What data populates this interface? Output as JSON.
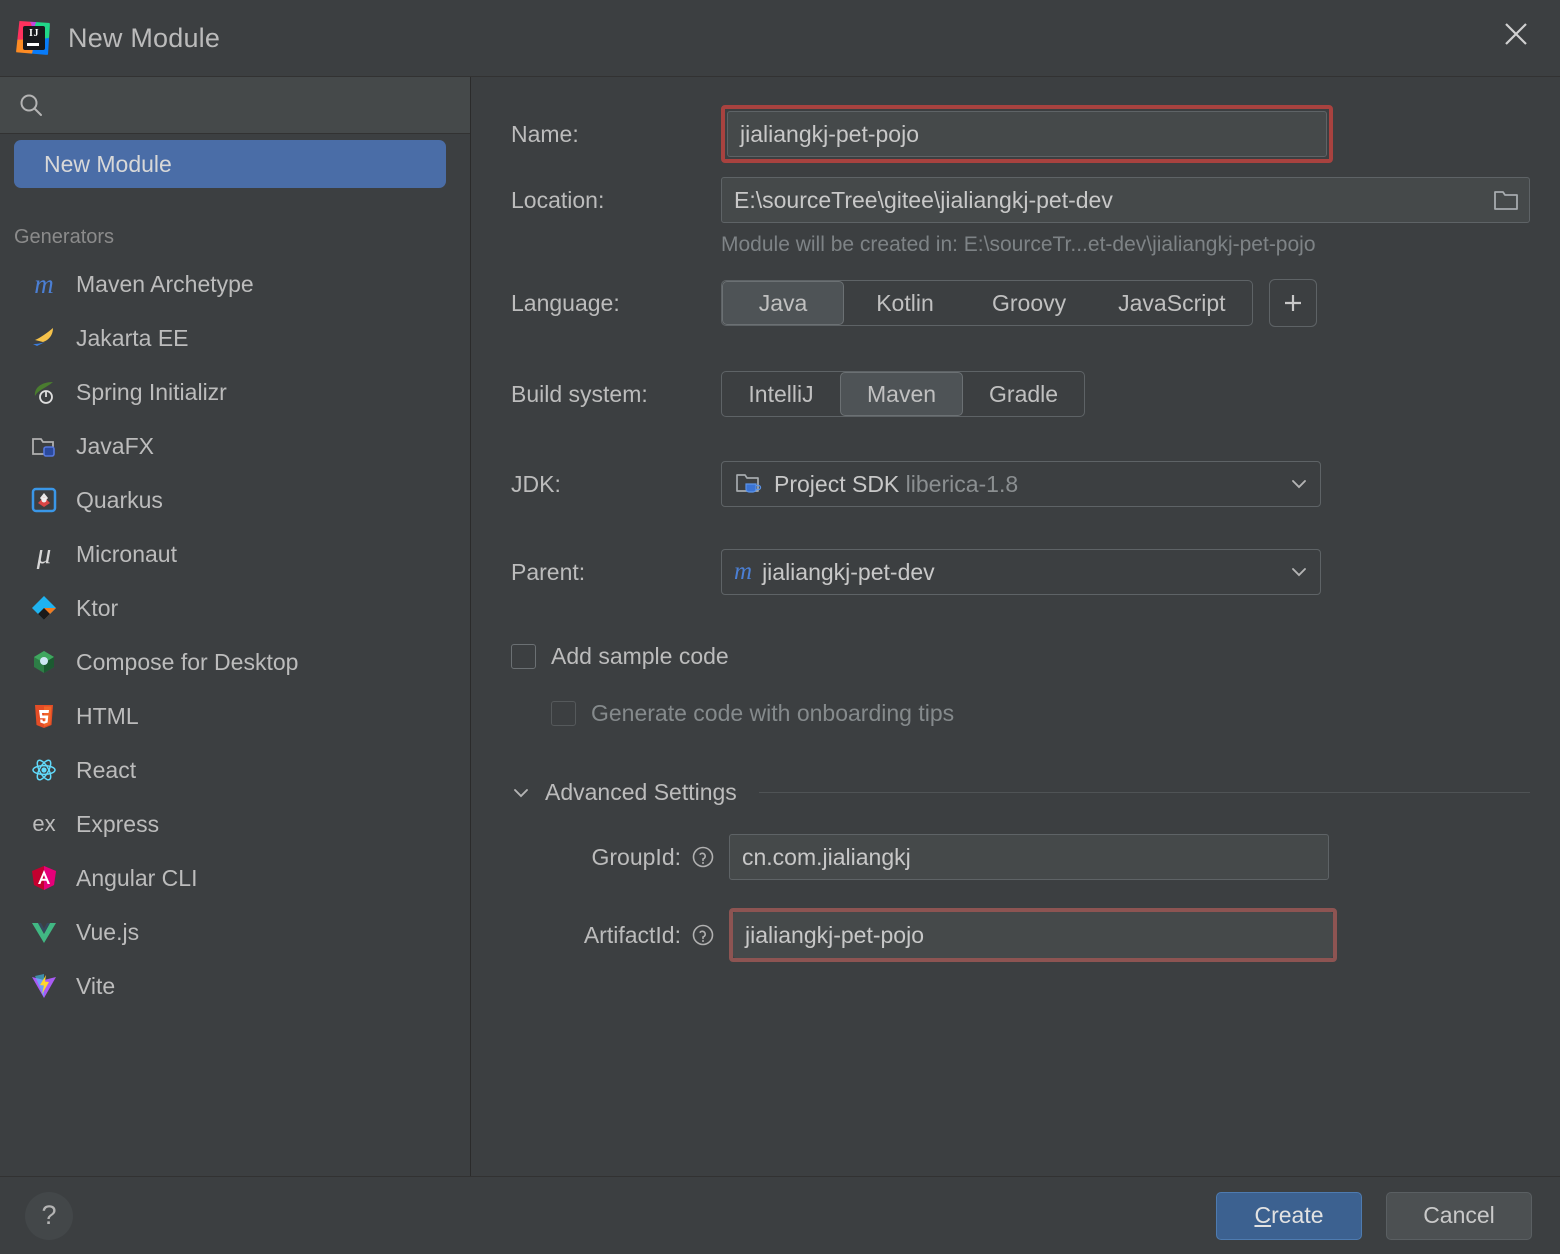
{
  "window": {
    "title": "New Module",
    "logo_icon": "intellij-idea-logo",
    "close_icon": "close-icon"
  },
  "sidebar": {
    "search": {
      "icon": "search-icon",
      "value": "",
      "placeholder": ""
    },
    "selected_item": "New Module",
    "generators_label": "Generators",
    "generators": [
      {
        "label": "Maven Archetype",
        "icon": "maven-icon"
      },
      {
        "label": "Jakarta EE",
        "icon": "jakarta-ee-icon"
      },
      {
        "label": "Spring Initializr",
        "icon": "spring-icon"
      },
      {
        "label": "JavaFX",
        "icon": "javafx-icon"
      },
      {
        "label": "Quarkus",
        "icon": "quarkus-icon"
      },
      {
        "label": "Micronaut",
        "icon": "micronaut-icon"
      },
      {
        "label": "Ktor",
        "icon": "ktor-icon"
      },
      {
        "label": "Compose for Desktop",
        "icon": "compose-icon"
      },
      {
        "label": "HTML",
        "icon": "html5-icon"
      },
      {
        "label": "React",
        "icon": "react-icon"
      },
      {
        "label": "Express",
        "icon": "express-icon"
      },
      {
        "label": "Angular CLI",
        "icon": "angular-icon"
      },
      {
        "label": "Vue.js",
        "icon": "vuejs-icon"
      },
      {
        "label": "Vite",
        "icon": "vite-icon"
      }
    ]
  },
  "form": {
    "name": {
      "label": "Name:",
      "value": "jialiangkj-pet-pojo",
      "highlight_color": "#a8423f"
    },
    "location": {
      "label": "Location:",
      "value": "E:\\sourceTree\\gitee\\jialiangkj-pet-dev",
      "browse_icon": "folder-icon"
    },
    "location_hint": "Module will be created in: E:\\sourceTr...et-dev\\jialiangkj-pet-pojo",
    "language": {
      "label": "Language:",
      "options": [
        "Java",
        "Kotlin",
        "Groovy",
        "JavaScript"
      ],
      "selected": "Java",
      "add_button_icon": "plus-icon"
    },
    "build_system": {
      "label": "Build system:",
      "options": [
        "IntelliJ",
        "Maven",
        "Gradle"
      ],
      "selected": "Maven"
    },
    "jdk": {
      "label": "JDK:",
      "icon": "jdk-folder-icon",
      "value": "Project SDK",
      "value_detail": "liberica-1.8",
      "chevron": "chevron-down-icon"
    },
    "parent": {
      "label": "Parent:",
      "icon": "maven-icon",
      "value": "jialiangkj-pet-dev",
      "chevron": "chevron-down-icon"
    },
    "add_sample_code": {
      "label": "Add sample code",
      "checked": false
    },
    "onboarding_tips": {
      "label": "Generate code with onboarding tips",
      "checked": false,
      "disabled": true
    },
    "advanced_settings": {
      "title": "Advanced Settings",
      "chevron": "chevron-down-icon",
      "group_id": {
        "label": "GroupId:",
        "value": "cn.com.jialiangkj",
        "help_icon": "help-icon"
      },
      "artifact_id": {
        "label": "ArtifactId:",
        "value": "jialiangkj-pet-pojo",
        "help_icon": "help-icon",
        "highlight_color": "#8d5452"
      }
    }
  },
  "footer": {
    "help_label": "?",
    "create_label_mnemonic": "C",
    "create_label_rest": "reate",
    "cancel_label": "Cancel",
    "primary_color": "#3c6190"
  }
}
